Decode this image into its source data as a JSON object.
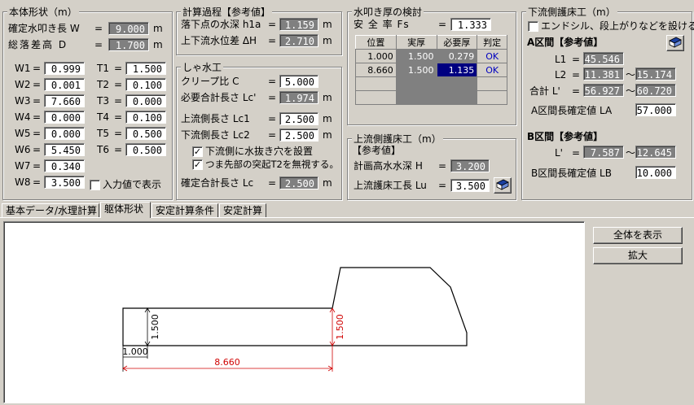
{
  "body_shape": {
    "title": "本体形状（m）",
    "width_label": "確定水叩き長 W",
    "width_value": "9.000",
    "width_unit": "m",
    "drop_label": "総落差高 D",
    "drop_value": "1.700",
    "drop_unit": "m",
    "w_rows": [
      {
        "w": "W1",
        "wv": "0.999",
        "t": "T1",
        "tv": "1.500"
      },
      {
        "w": "W2",
        "wv": "0.001",
        "t": "T2",
        "tv": "0.100"
      },
      {
        "w": "W3",
        "wv": "7.660",
        "t": "T3",
        "tv": "0.000"
      },
      {
        "w": "W4",
        "wv": "0.000",
        "t": "T4",
        "tv": "0.100"
      },
      {
        "w": "W5",
        "wv": "0.000",
        "t": "T5",
        "tv": "0.500"
      },
      {
        "w": "W6",
        "wv": "5.450",
        "t": "T6",
        "tv": "0.500"
      },
      {
        "w": "W7",
        "wv": "0.340"
      },
      {
        "w": "W8",
        "wv": "3.500"
      }
    ],
    "show_input_label": "入力値で表示"
  },
  "calc": {
    "title": "計算過程【参考値】",
    "h1a_label": "落下点の水深 h1a",
    "h1a_value": "1.159",
    "h1a_unit": "m",
    "dh_label": "上下流水位差 ΔH",
    "dh_value": "2.710",
    "dh_unit": "m"
  },
  "cutoff": {
    "title": "しゃ水工",
    "creep_label": "クリープ比 C",
    "creep_value": "5.000",
    "req_label": "必要合計長さ Lc'",
    "req_value": "1.974",
    "req_unit": "m",
    "up_label": "上流側長さ Lc1",
    "up_value": "2.500",
    "up_unit": "m",
    "down_label": "下流側長さ Lc2",
    "down_value": "2.500",
    "down_unit": "m",
    "chk1_label": "下流側に水抜き穴を設置",
    "chk2_label": "つま先部の突起T2を無視する。",
    "final_label": "確定合計長さ Lc",
    "final_value": "2.500",
    "final_unit": "m"
  },
  "apron": {
    "title": "水叩き厚の検討",
    "safety_label": "安 全 率 Fs",
    "safety_value": "1.333",
    "headers": [
      "位置",
      "実厚",
      "必要厚",
      "判定"
    ],
    "rows": [
      {
        "pos": "1.000",
        "act": "1.500",
        "req": "0.279",
        "judge": "OK"
      },
      {
        "pos": "8.660",
        "act": "1.500",
        "req": "1.135",
        "judge": "OK"
      }
    ]
  },
  "upstream": {
    "title": "上流側護床工（m）",
    "ref_label": "【参考値】",
    "plan_label": "計画高水水深 H",
    "plan_value": "3.200",
    "len_label": "上流護床工長 Lu",
    "len_value": "3.500"
  },
  "downstream": {
    "title": "下流側護床工（m）",
    "endsill_label": "エンドシル、段上がりなどを設ける",
    "a_title": "A区間【参考値】",
    "l1_label": "L1",
    "l1_value": "45.546",
    "l2_label": "L2",
    "l2_from": "11.381",
    "l2_to": "15.174",
    "sum_label": "合計 L'",
    "sum_from": "56.927",
    "sum_to": "60.720",
    "a_conf_label": "A区間長確定値 LA",
    "a_conf_value": "57.000",
    "b_title": "B区間【参考値】",
    "b_label": "L'",
    "b_from": "7.587",
    "b_to": "12.645",
    "b_conf_label": "B区間長確定値 LB",
    "b_conf_value": "10.000",
    "tilde": "〜"
  },
  "tabs": [
    "基本データ/水理計算",
    "躯体形状",
    "安定計算条件",
    "安定計算"
  ],
  "buttons": {
    "show_all": "全体を表示",
    "zoom": "拡大"
  },
  "drawing": {
    "dim_height1": "1.500",
    "dim_height2": "1.500",
    "dim_w1": "1.000",
    "dim_len": "8.660"
  },
  "eq": "="
}
